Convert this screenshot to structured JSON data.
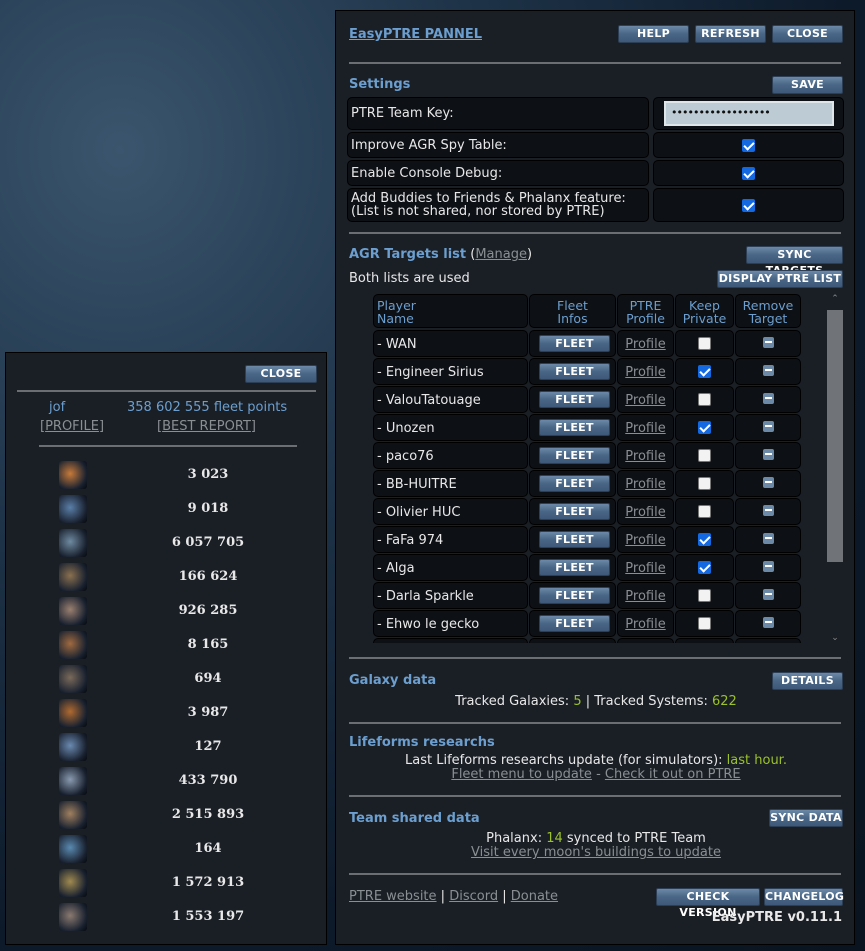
{
  "left_panel": {
    "close_label": "CLOSE",
    "player": "jof",
    "fleet_points": "358 602 555 fleet points",
    "profile_link": "PROFILE",
    "best_report_link": "BEST REPORT",
    "ships": [
      "3 023",
      "9 018",
      "6 057 705",
      "166 624",
      "926 285",
      "8 165",
      "694",
      "3 987",
      "127",
      "433 790",
      "2 515 893",
      "164",
      "1 572 913",
      "1 553 197"
    ]
  },
  "main": {
    "title": "EasyPTRE PANNEL",
    "help_label": "HELP",
    "refresh_label": "REFRESH",
    "close_label": "CLOSE",
    "settings": {
      "heading": "Settings",
      "save_label": "SAVE",
      "team_key_label": "PTRE Team Key:",
      "team_key_value": "••••••••••••••••••",
      "improve_agr_label": "Improve AGR Spy Table:",
      "improve_agr": true,
      "console_debug_label": "Enable Console Debug:",
      "console_debug": true,
      "buddies_label_1": "Add Buddies to Friends & Phalanx feature:",
      "buddies_label_2": "(List is not shared, nor stored by PTRE)",
      "buddies": true
    },
    "targets": {
      "heading": "AGR Targets list",
      "manage_link": "Manage",
      "sync_label": "SYNC TARGETS",
      "display_label": "DISPLAY PTRE LIST",
      "status": "Both lists are used",
      "columns": [
        "Player\nName",
        "Fleet\nInfos",
        "PTRE\nProfile",
        "Keep\nPrivate",
        "Remove\nTarget"
      ],
      "fleet_label": "FLEET",
      "profile_label": "Profile",
      "rows": [
        {
          "name": "- WAN",
          "private": false
        },
        {
          "name": "- Engineer Sirius",
          "private": true
        },
        {
          "name": "- ValouTatouage",
          "private": false
        },
        {
          "name": "- Unozen",
          "private": true
        },
        {
          "name": "- paco76",
          "private": false
        },
        {
          "name": "- BB-HUITRE",
          "private": false
        },
        {
          "name": "- Olivier HUC",
          "private": false
        },
        {
          "name": "- FaFa 974",
          "private": true
        },
        {
          "name": "- Alga",
          "private": true
        },
        {
          "name": "- Darla Sparkle",
          "private": false
        },
        {
          "name": "- Ehwo le gecko",
          "private": false
        }
      ]
    },
    "galaxy": {
      "heading": "Galaxy data",
      "details_label": "DETAILS",
      "galaxies_label": "Tracked Galaxies:",
      "galaxies": "5",
      "sep": "|",
      "systems_label": "Tracked Systems:",
      "systems": "622"
    },
    "lifeforms": {
      "heading": "Lifeforms researchs",
      "text": "Last Lifeforms researchs update (for simulators):",
      "when": "last hour.",
      "fleet_link": "Fleet menu to update",
      "dash": "-",
      "ptre_link": "Check it out on PTRE"
    },
    "team": {
      "heading": "Team shared data",
      "sync_label": "SYNC DATA",
      "phalanx_label": "Phalanx:",
      "phalanx_count": "14",
      "phalanx_text": "synced to PTRE Team",
      "visit_link": "Visit every moon's buildings to update"
    },
    "footer": {
      "website": "PTRE website",
      "discord": "Discord",
      "donate": "Donate",
      "sep": "|",
      "check_version": "CHECK VERSION",
      "changelog": "CHANGELOG",
      "version": "EasyPTRE v0.11.1"
    }
  }
}
